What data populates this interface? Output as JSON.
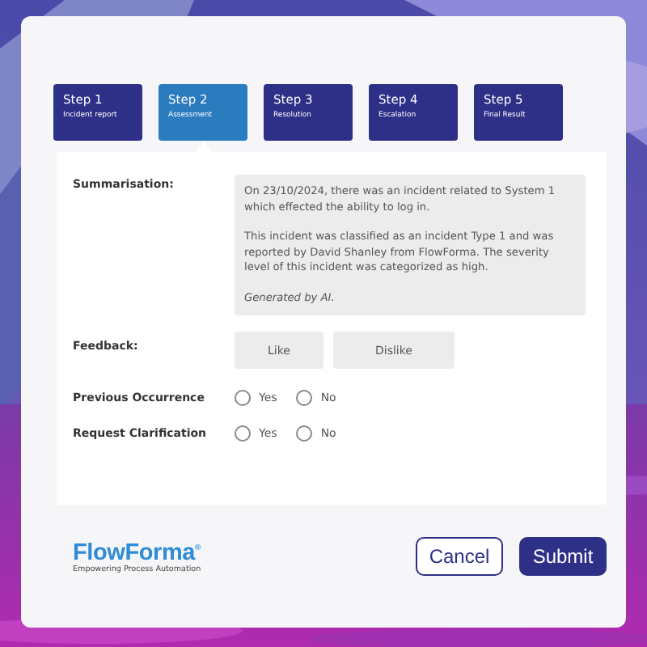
{
  "steps": [
    {
      "title": "Step 1",
      "subtitle": "Incident report",
      "selected": false
    },
    {
      "title": "Step 2",
      "subtitle": "Assessment",
      "selected": true
    },
    {
      "title": "Step 3",
      "subtitle": "Resolution",
      "selected": false
    },
    {
      "title": "Step 4",
      "subtitle": "Escalation",
      "selected": false
    },
    {
      "title": "Step 5",
      "subtitle": "Final Result",
      "selected": false
    }
  ],
  "summary": {
    "label": "Summarisation:",
    "paragraphs": [
      {
        "kind": "body",
        "text": "On 23/10/2024, there was an incident related to System 1 which effected the ability to log in."
      },
      {
        "kind": "body",
        "text": "This incident was classified as an incident Type 1 and was reported by David Shanley from FlowForma. The severity level of this incident was categorized as high."
      },
      {
        "kind": "note",
        "text": "Generated by AI."
      }
    ]
  },
  "feedback": {
    "label": "Feedback:",
    "buttons": [
      "Like",
      "Dislike"
    ]
  },
  "questions": [
    {
      "label": "Previous Occurrence",
      "options": [
        {
          "label": "Yes",
          "selected": false
        },
        {
          "label": "No",
          "selected": false
        }
      ]
    },
    {
      "label": "Request Clarification",
      "options": [
        {
          "label": "Yes",
          "selected": false
        },
        {
          "label": "No",
          "selected": false
        }
      ]
    }
  ],
  "logo": {
    "name": "FlowForma$^{®}$",
    "tagline": "Empowering Process Automation"
  },
  "actions": [
    {
      "label": "Cancel",
      "kind": "secondary"
    },
    {
      "label": "Submit",
      "kind": "primary"
    }
  ]
}
